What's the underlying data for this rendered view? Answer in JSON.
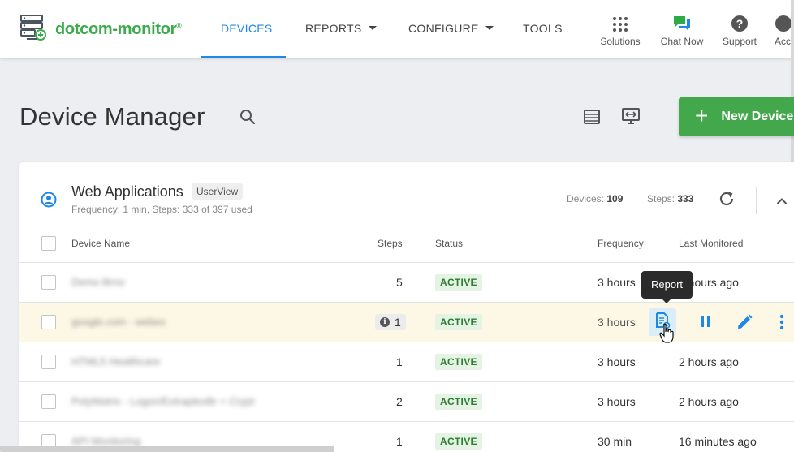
{
  "brand": {
    "name": "dotcom-monitor",
    "reg": "®",
    "color": "#3bab4b"
  },
  "nav": {
    "devices": "DEVICES",
    "reports": "REPORTS",
    "configure": "CONFIGURE",
    "tools": "TOOLS"
  },
  "toolbar": {
    "solutions": "Solutions",
    "chat": "Chat Now",
    "support": "Support",
    "account": "Acc"
  },
  "page": {
    "title": "Device Manager",
    "new_device": "New Device"
  },
  "group": {
    "name": "Web Applications",
    "badge": "UserView",
    "subtitle": "Frequency: 1 min, Steps: 333 of 397 used",
    "devices_label": "Devices:",
    "devices_value": "109",
    "steps_label": "Steps:",
    "steps_value": "333"
  },
  "table": {
    "columns": {
      "name": "Device Name",
      "steps": "Steps",
      "status": "Status",
      "frequency": "Frequency",
      "last": "Last Monitored"
    },
    "rows": [
      {
        "name": "Demo Brno",
        "steps": "5",
        "status": "ACTIVE",
        "frequency": "3 hours",
        "last": "2 hours ago"
      },
      {
        "name": "google.com - webex",
        "steps": "1",
        "status": "ACTIVE",
        "frequency": "3 hours",
        "last": ""
      },
      {
        "name": "HTML5 Healthcare",
        "steps": "1",
        "status": "ACTIVE",
        "frequency": "3 hours",
        "last": "2 hours ago"
      },
      {
        "name": "PolyMatrix - Logon/ExtraplexBr + Crypt",
        "steps": "2",
        "status": "ACTIVE",
        "frequency": "3 hours",
        "last": "2 hours ago"
      },
      {
        "name": "API Monitoring",
        "steps": "1",
        "status": "ACTIVE",
        "frequency": "30 min",
        "last": "16 minutes ago"
      }
    ]
  },
  "tooltip": {
    "text": "Report"
  },
  "colors": {
    "accent": "#1e88e5",
    "primary_button": "#43a84c",
    "active_badge": "#2e7d32",
    "highlight_row": "#fdf8e6"
  }
}
